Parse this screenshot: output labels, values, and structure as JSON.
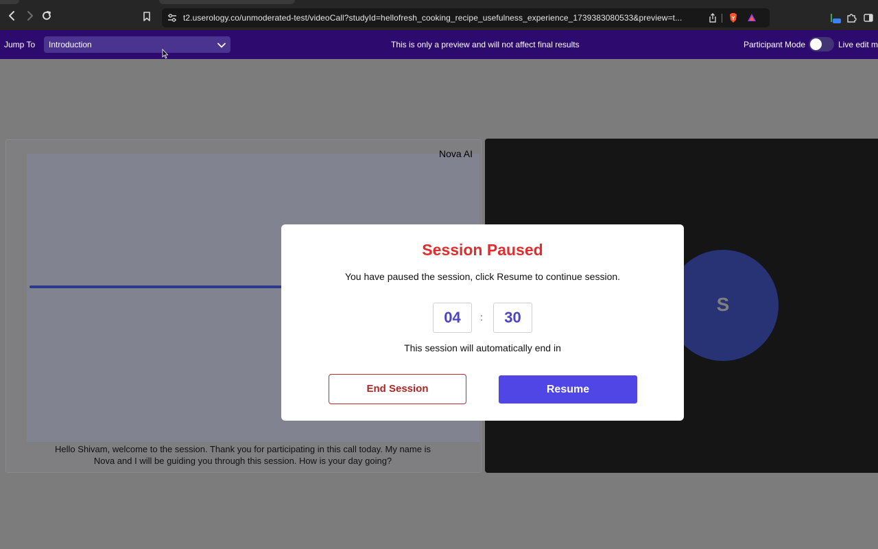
{
  "browser": {
    "url": "t2.userology.co/unmoderated-test/videoCall?studyId=hellofresh_cooking_recipe_usefulness_experience_1739383080533&preview=t..."
  },
  "preview_bar": {
    "jump_label": "Jump To",
    "jump_selected": "Introduction",
    "notice": "This is only a preview and will not affect final results",
    "participant_mode_label": "Participant Mode",
    "participant_mode_on": false,
    "live_edit_label": "Live edit m"
  },
  "ai_tile": {
    "name": "Nova AI",
    "caption_line1": "Hello Shivam, welcome to the session. Thank you for participating in this call today. My name is",
    "caption_line2": "Nova and I will be guiding you through this session. How is your day going?"
  },
  "user_tile": {
    "avatar_letter": "S"
  },
  "modal": {
    "title": "Session Paused",
    "description": "You have paused the session, click Resume to continue session.",
    "timer_minutes": "04",
    "timer_separator": ":",
    "timer_seconds": "30",
    "auto_end_text": "This session will automatically end in",
    "end_button": "End Session",
    "resume_button": "Resume"
  },
  "colors": {
    "preview_bar_bg": "#2d0a6e",
    "title_red": "#e12d2d",
    "resume_blue": "#4f46e5",
    "avatar_blue": "#273374"
  },
  "icons": [
    "back-icon",
    "forward-icon",
    "reload-icon",
    "bookmark-icon",
    "site-settings-icon",
    "share-icon",
    "brave-shield-icon",
    "brave-rewards-icon",
    "extension-icon",
    "puzzle-icon",
    "sidebar-icon",
    "chevron-down-icon",
    "cursor-icon"
  ]
}
